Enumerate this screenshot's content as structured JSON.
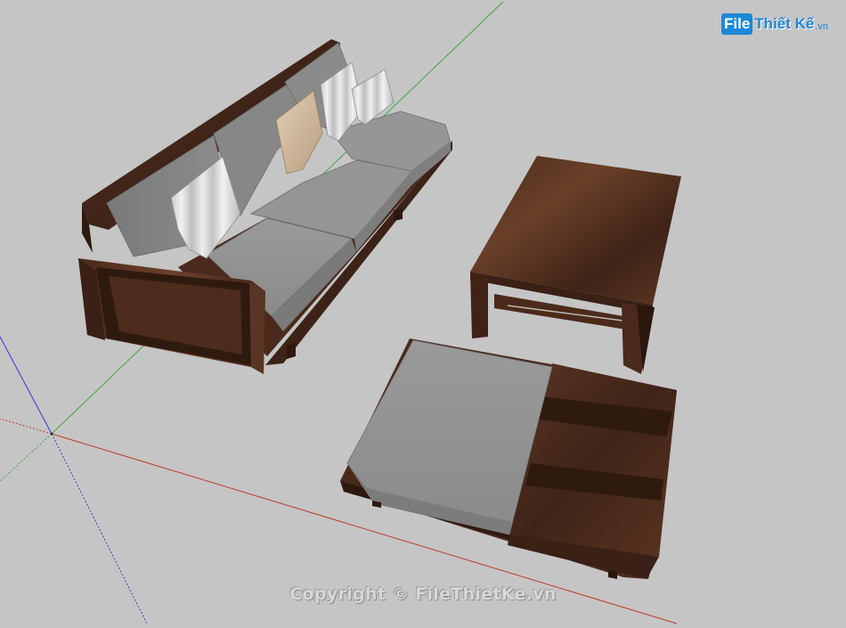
{
  "watermark": {
    "logo_box": "File",
    "logo_rest": "Thiết Kế",
    "logo_tld": ".vn",
    "copyright": "Copyright © FileThietKe.vn"
  },
  "colors": {
    "background": "#c5c5c5",
    "axis_red": "#c0392b",
    "axis_green": "#3fa83f",
    "axis_blue": "#3a3ad0",
    "wood_dark": "#3a2016",
    "wood_mid": "#5a3422",
    "cushion": "#8a8a8a",
    "accent_logo": "#1e88d8"
  },
  "icons": [
    "sofa-model",
    "coffee-table-model",
    "ottoman-model",
    "axis-origin"
  ]
}
